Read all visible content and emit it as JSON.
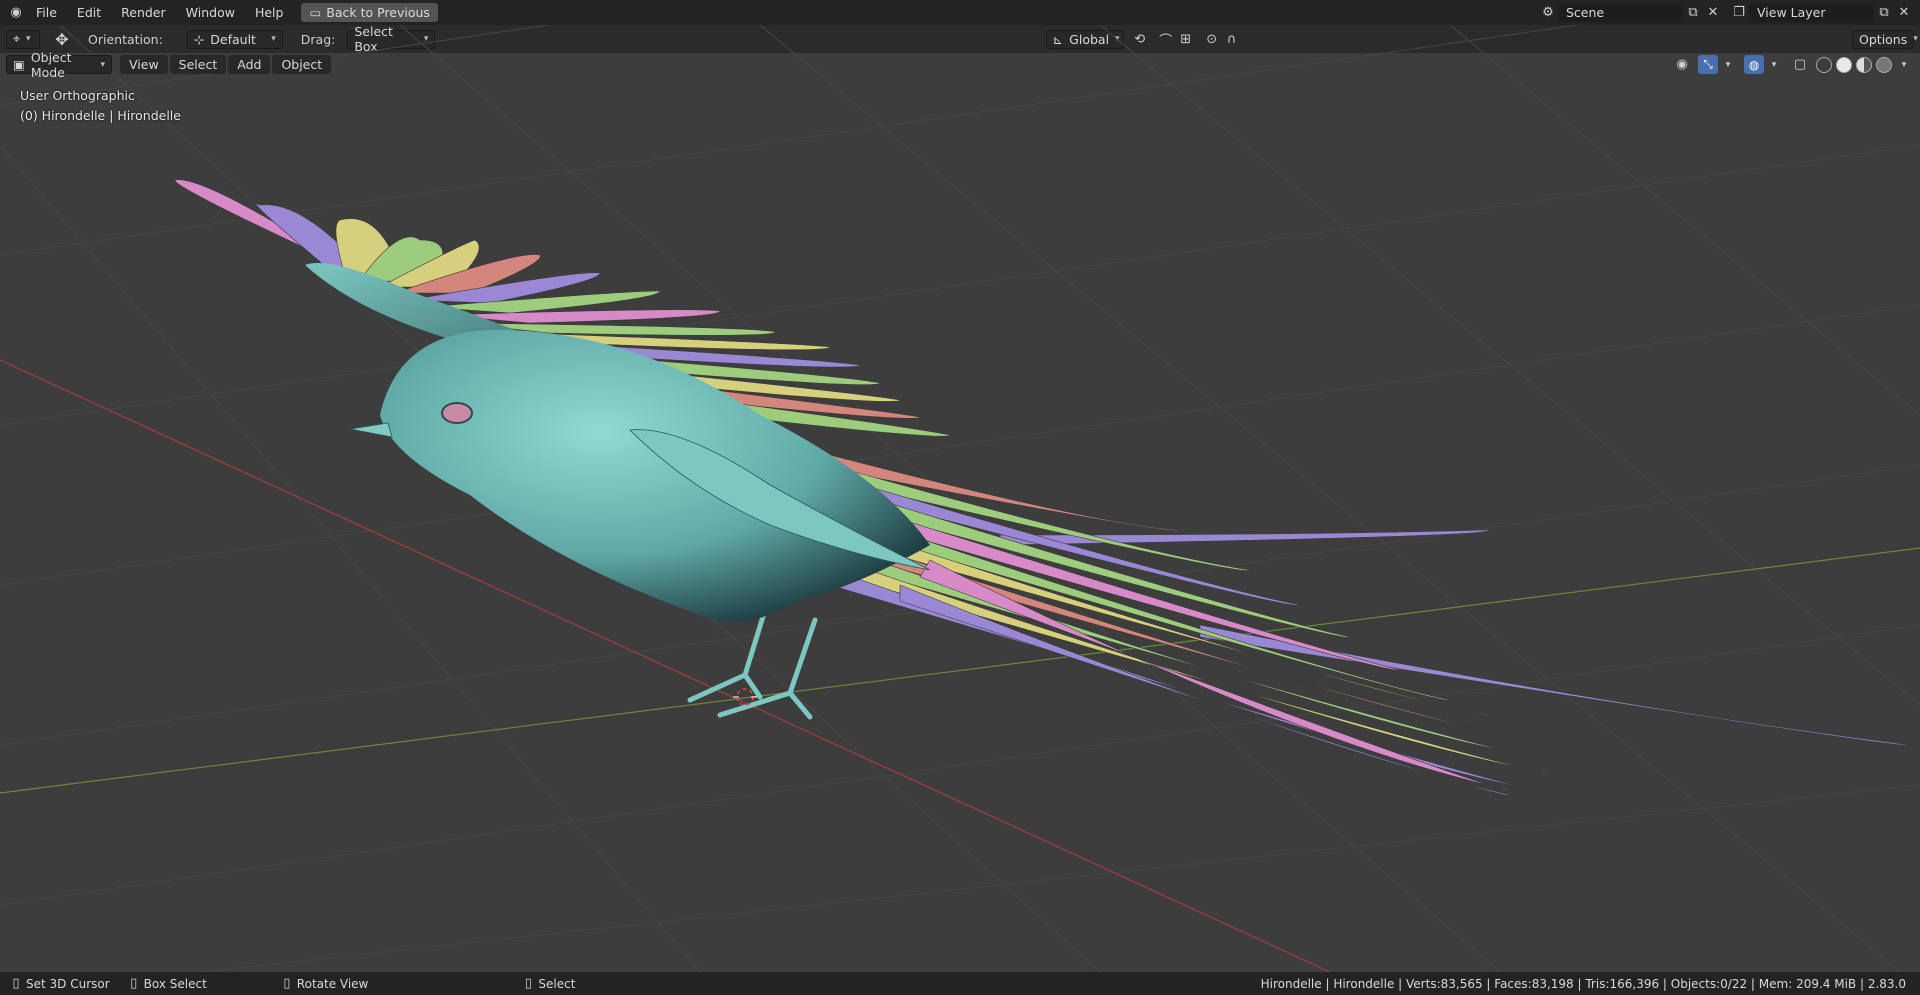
{
  "topbar": {
    "menus": [
      "File",
      "Edit",
      "Render",
      "Window",
      "Help"
    ],
    "back_button": "Back to Previous",
    "scene": "Scene",
    "view_layer": "View Layer"
  },
  "toolheader": {
    "orientation_label": "Orientation:",
    "orientation_value": "Default",
    "drag_label": "Drag:",
    "drag_value": "Select Box",
    "transform_orientation": "Global",
    "options_label": "Options"
  },
  "viewheader": {
    "mode": "Object Mode",
    "menus": [
      "View",
      "Select",
      "Add",
      "Object"
    ]
  },
  "overlay": {
    "view_name": "User Orthographic",
    "object_info": "(0) Hirondelle | Hirondelle"
  },
  "status": {
    "left_action": "Set 3D Cursor",
    "middle_action": "Box Select",
    "rotate_action": "Rotate View",
    "right_action": "Select",
    "stats": "Hirondelle | Hirondelle | Verts:83,565 | Faces:83,198 | Tris:166,396 | Objects:0/22 | Mem: 209.4 MiB | 2.83.0"
  },
  "colors": {
    "body": "#6fbdb8",
    "feather_pink": "#d88ac8",
    "feather_purple": "#9a88d4",
    "feather_green": "#9ccc7c",
    "feather_yellow": "#d6d07c",
    "feather_salmon": "#d4867c",
    "x_axis": "#a83c3c",
    "y_axis": "#6a8a3a"
  }
}
